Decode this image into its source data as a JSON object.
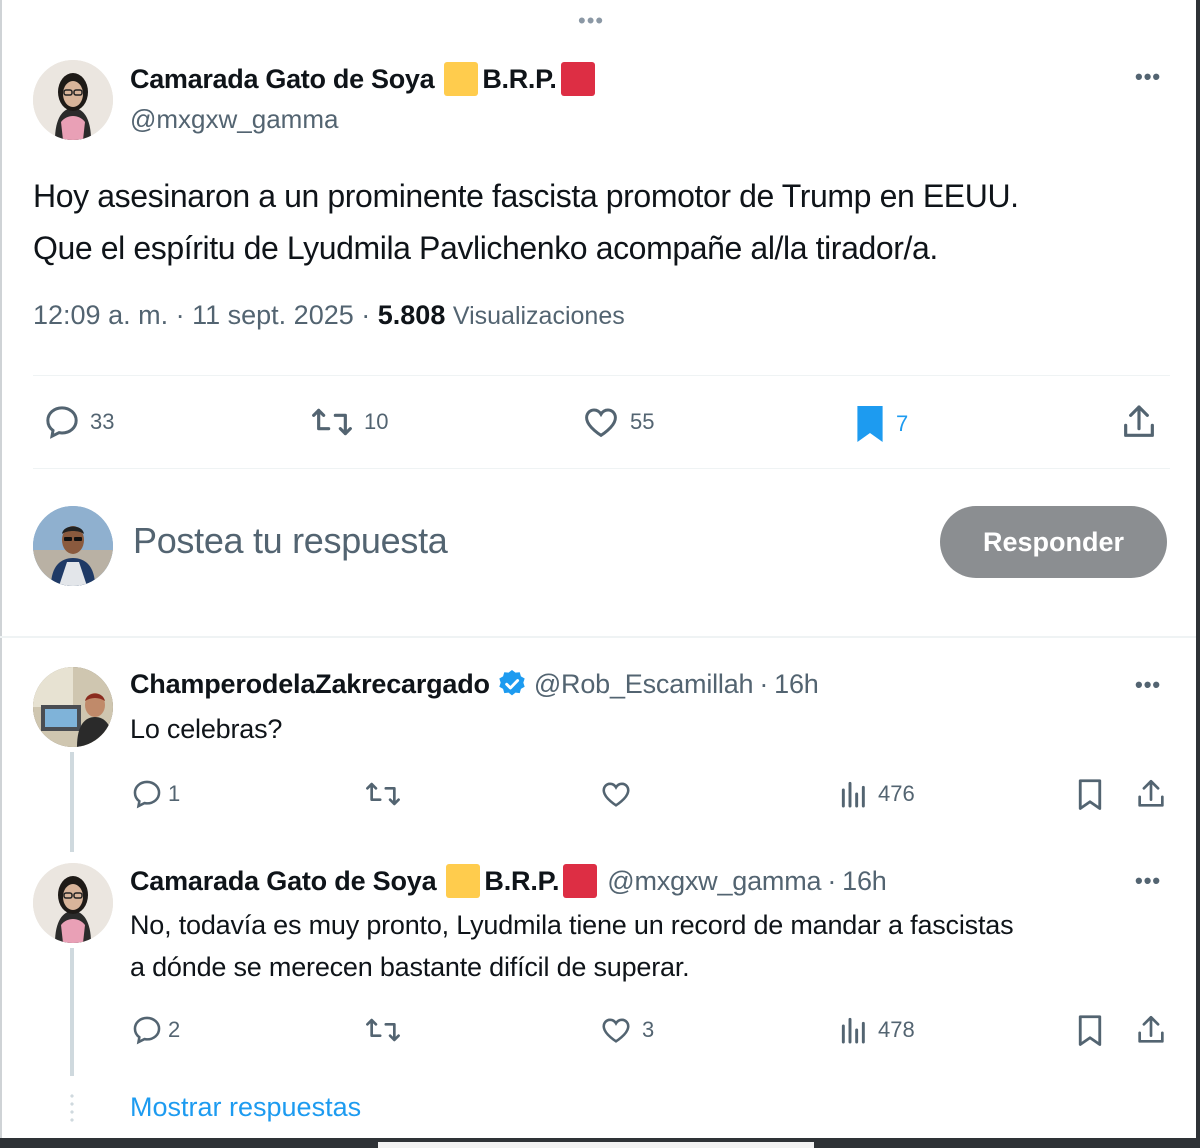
{
  "main_post": {
    "author_name": "Camarada Gato de Soya",
    "flag_text": "B.R.P.",
    "handle": "@mxgxw_gamma",
    "text_line1": "Hoy asesinaron a un prominente fascista promotor de Trump en EEUU.",
    "text_line2": "Que el espíritu de Lyudmila Pavlichenko acompañe al/la tirador/a.",
    "time": "12:09 a. m.",
    "date": "11 sept. 2025",
    "views_count": "5.808",
    "views_label": "Visualizaciones",
    "stats": {
      "replies": "33",
      "reposts": "10",
      "likes": "55",
      "bookmarks": "7"
    },
    "colors": {
      "bookmark_active": "#1d9bf0",
      "flag_yellow": "#ffcc4d",
      "flag_red": "#dd2e44"
    }
  },
  "compose": {
    "placeholder": "Postea tu respuesta",
    "button_label": "Responder"
  },
  "replies": [
    {
      "author_name": "ChamperodelaZakrecargado",
      "verified": true,
      "handle": "@Rob_Escamillah",
      "time": "16h",
      "text": "Lo celebras?",
      "stats": {
        "replies": "1",
        "reposts": "",
        "likes": "",
        "views": "476"
      }
    },
    {
      "author_name": "Camarada Gato de Soya",
      "flag_text": "B.R.P.",
      "handle": "@mxgxw_gamma",
      "time": "16h",
      "text_line1": "No, todavía es muy pronto, Lyudmila tiene un record de mandar a fascistas",
      "text_line2": "a dónde se merecen bastante difícil de superar.",
      "stats": {
        "replies": "2",
        "reposts": "",
        "likes": "3",
        "views": "478"
      }
    }
  ],
  "show_replies_label": "Mostrar respuestas",
  "icons": [
    "more-icon",
    "reply-icon",
    "repost-icon",
    "like-icon",
    "bookmark-icon",
    "share-icon",
    "views-icon",
    "verified-icon"
  ]
}
